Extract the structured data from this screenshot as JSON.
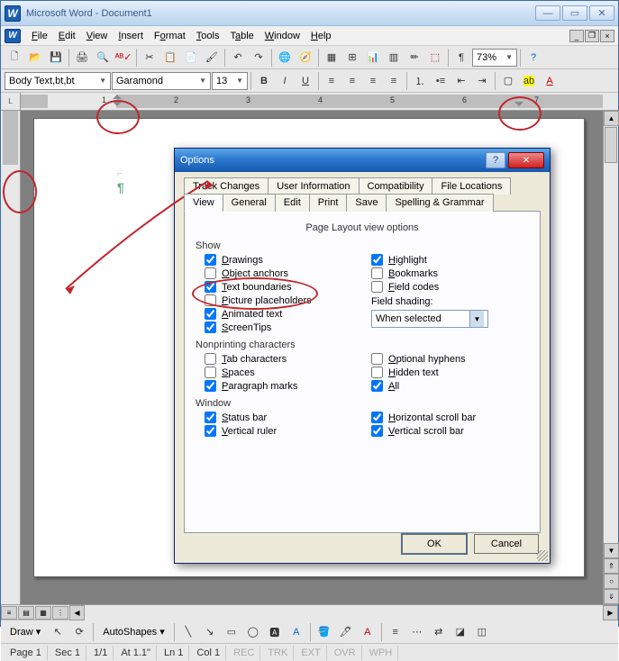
{
  "window": {
    "title": "Microsoft Word - Document1"
  },
  "menu": {
    "file": "File",
    "edit": "Edit",
    "view": "View",
    "insert": "Insert",
    "format": "Format",
    "tools": "Tools",
    "table": "Table",
    "window": "Window",
    "help": "Help"
  },
  "toolbar1": {
    "zoom": "73%"
  },
  "toolbar2": {
    "style": "Body Text,bt,bt",
    "font": "Garamond",
    "size": "13"
  },
  "ruler": {
    "marks": [
      "1",
      "2",
      "3",
      "4",
      "5",
      "6",
      "7"
    ]
  },
  "drawbar": {
    "draw": "Draw",
    "autoshapes": "AutoShapes"
  },
  "status": {
    "page": "Page 1",
    "sec": "Sec 1",
    "pages": "1/1",
    "at": "At 1.1\"",
    "ln": "Ln 1",
    "col": "Col 1",
    "rec": "REC",
    "trk": "TRK",
    "ext": "EXT",
    "ovr": "OVR",
    "wph": "WPH"
  },
  "dialog": {
    "title": "Options",
    "tabs_row1": [
      "Track Changes",
      "User Information",
      "Compatibility",
      "File Locations"
    ],
    "tabs_row2": [
      "View",
      "General",
      "Edit",
      "Print",
      "Save",
      "Spelling & Grammar"
    ],
    "active_tab": "View",
    "panel_title": "Page Layout view options",
    "groups": {
      "show": {
        "label": "Show",
        "left": [
          {
            "l": "Drawings",
            "c": true
          },
          {
            "l": "Object anchors",
            "c": false
          },
          {
            "l": "Text boundaries",
            "c": true
          },
          {
            "l": "Picture placeholders",
            "c": false
          },
          {
            "l": "Animated text",
            "c": true
          },
          {
            "l": "ScreenTips",
            "c": true
          }
        ],
        "right": [
          {
            "l": "Highlight",
            "c": true
          },
          {
            "l": "Bookmarks",
            "c": false
          },
          {
            "l": "Field codes",
            "c": false
          }
        ],
        "shading_label": "Field shading:",
        "shading_value": "When selected"
      },
      "nonprint": {
        "label": "Nonprinting characters",
        "left": [
          {
            "l": "Tab characters",
            "c": false
          },
          {
            "l": "Spaces",
            "c": false
          },
          {
            "l": "Paragraph marks",
            "c": true
          }
        ],
        "right": [
          {
            "l": "Optional hyphens",
            "c": false
          },
          {
            "l": "Hidden text",
            "c": false
          },
          {
            "l": "All",
            "c": true
          }
        ]
      },
      "window": {
        "label": "Window",
        "left": [
          {
            "l": "Status bar",
            "c": true
          },
          {
            "l": "Vertical ruler",
            "c": true
          }
        ],
        "right": [
          {
            "l": "Horizontal scroll bar",
            "c": true
          },
          {
            "l": "Vertical scroll bar",
            "c": true
          }
        ]
      }
    },
    "ok": "OK",
    "cancel": "Cancel"
  }
}
